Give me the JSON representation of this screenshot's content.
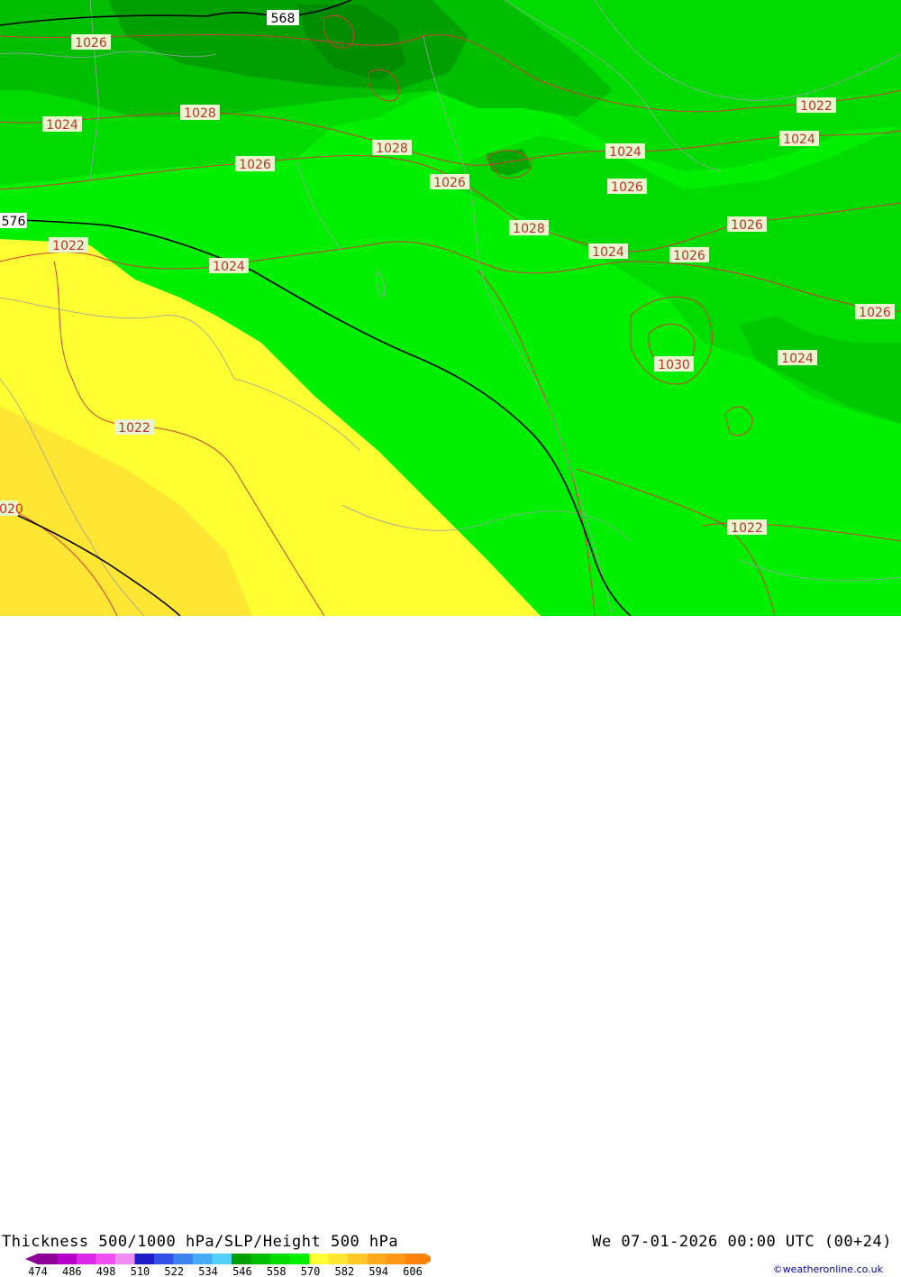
{
  "title": "Thickness 500/1000 hPa/SLP/Height 500 hPa",
  "datetime": "We 07-01-2026 00:00 UTC (00+24)",
  "credit": "©weatheronline.co.uk",
  "legend": {
    "ticks": [
      "474",
      "486",
      "498",
      "510",
      "522",
      "534",
      "546",
      "558",
      "570",
      "582",
      "594",
      "606"
    ],
    "colors": [
      "#8c0096",
      "#b400c8",
      "#dc28e6",
      "#f050f0",
      "#f08cf0",
      "#1e1ec8",
      "#3250e6",
      "#3c82f0",
      "#46aaf5",
      "#50d2fa",
      "#00a000",
      "#00be00",
      "#00dc00",
      "#00f000",
      "#ffff32",
      "#ffe632",
      "#ffc828",
      "#ffaa1e",
      "#ff9614",
      "#ff820a"
    ]
  },
  "map": {
    "isobar_labels": [
      "1026",
      "1024",
      "1028",
      "1026",
      "1028",
      "1026",
      "1028",
      "1024",
      "1026",
      "1022",
      "1024",
      "1022",
      "1024",
      "1028",
      "1024",
      "1026",
      "1026",
      "1026",
      "1030",
      "1024",
      "1022",
      "1022",
      "1020",
      "1020"
    ],
    "height_labels": [
      "568",
      "576"
    ]
  }
}
